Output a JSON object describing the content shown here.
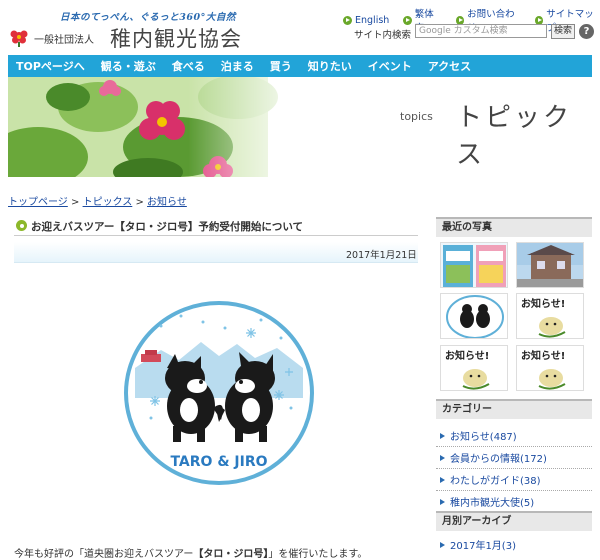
{
  "header": {
    "tagline": "日本のてっぺん、ぐるっと360°大自然",
    "org_type": "一般社団法人",
    "org_name": "稚内観光協会",
    "util_links": [
      {
        "label": "English"
      },
      {
        "label": "繁体字"
      },
      {
        "label": "お問い合わせ"
      },
      {
        "label": "サイトマップ"
      }
    ],
    "search_label": "サイト内検索",
    "search_placeholder": "Google カスタム検索",
    "search_button": "検索",
    "help_glyph": "?"
  },
  "nav": {
    "items": [
      "TOPページへ",
      "観る・遊ぶ",
      "食べる",
      "泊まる",
      "買う",
      "知りたい",
      "イベント",
      "アクセス"
    ]
  },
  "banner": {
    "subtitle": "topics",
    "title": "トピックス"
  },
  "breadcrumb": {
    "items": [
      "トップページ",
      "トピックス",
      "お知らせ"
    ],
    "separator": ">"
  },
  "article": {
    "title": "お迎えバスツアー【タロ・ジロ号】予約受付開始について",
    "date": "2017年1月21日",
    "logo_text": "TARO & JIRO",
    "body_start": "今年も好評の「道央圏お迎えバスツアー",
    "body_strong": "【タロ・ジロ号】",
    "body_end": "」を催行いたします。"
  },
  "sidebar": {
    "recent_photos_heading": "最近の写真",
    "photo_labels": [
      "お知らせ!",
      "お知らせ!",
      "お知らせ!"
    ],
    "category_heading": "カテゴリー",
    "categories": [
      {
        "label": "お知らせ(487)"
      },
      {
        "label": "会員からの情報(172)"
      },
      {
        "label": "わたしがガイド(38)"
      },
      {
        "label": "稚内市観光大使(5)"
      }
    ],
    "archive_heading": "月別アーカイブ",
    "archive_first": "2017年1月(3)"
  },
  "colors": {
    "nav_bg": "#22a4d8",
    "bullet_green": "#8cb82a",
    "link_blue": "#1a4aa0"
  }
}
